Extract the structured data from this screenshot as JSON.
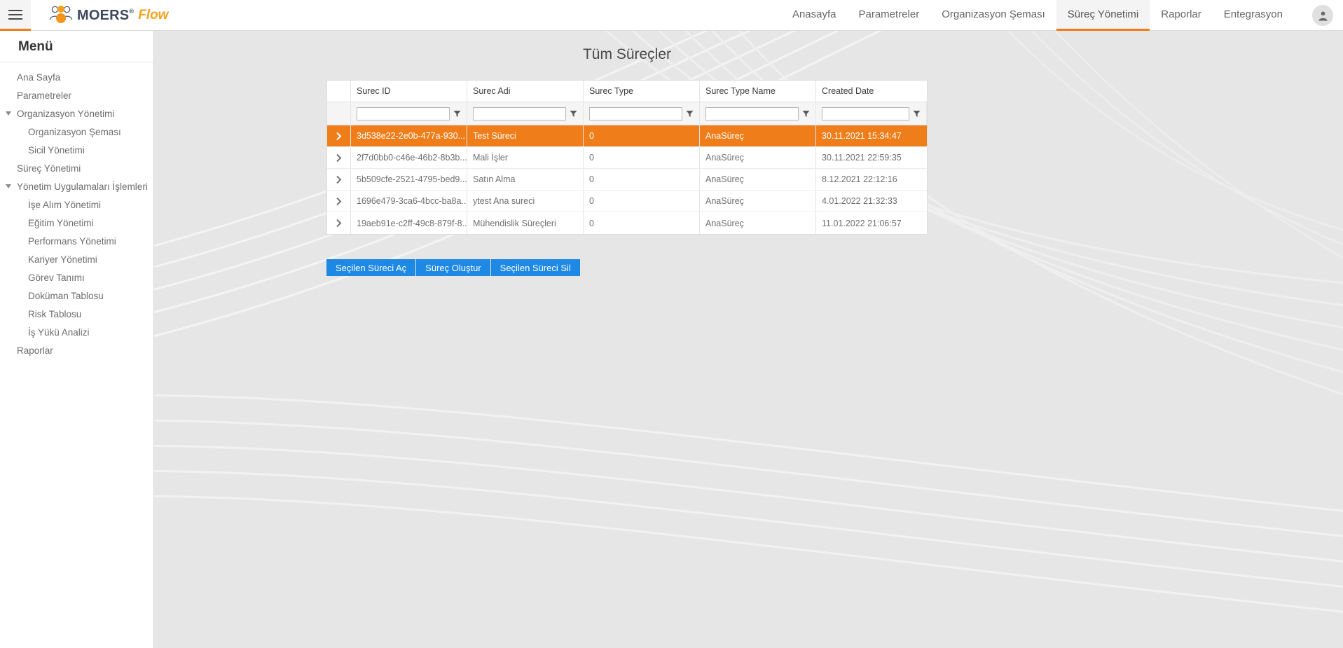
{
  "brand": {
    "name": "MOERS",
    "reg": "®",
    "suffix": "Flow",
    "logo_icon": "people-group-icon",
    "hamburger_icon": "hamburger-menu-icon"
  },
  "topnav": {
    "items": [
      {
        "label": "Anasayfa",
        "active": false
      },
      {
        "label": "Parametreler",
        "active": false
      },
      {
        "label": "Organizasyon Şeması",
        "active": false
      },
      {
        "label": "Süreç Yönetimi",
        "active": true
      },
      {
        "label": "Raporlar",
        "active": false
      },
      {
        "label": "Entegrasyon",
        "active": false
      }
    ],
    "avatar_icon": "user-avatar-icon"
  },
  "sidebar": {
    "title": "Menü",
    "items": [
      {
        "label": "Ana Sayfa",
        "level": 1,
        "caret": "none"
      },
      {
        "label": "Parametreler",
        "level": 1,
        "caret": "none"
      },
      {
        "label": "Organizasyon Yönetimi",
        "level": 1,
        "caret": "open"
      },
      {
        "label": "Organizasyon Şeması",
        "level": 2,
        "caret": "none"
      },
      {
        "label": "Sicil Yönetimi",
        "level": 2,
        "caret": "none"
      },
      {
        "label": "Süreç Yönetimi",
        "level": 1,
        "caret": "none"
      },
      {
        "label": "Yönetim Uygulamaları İşlemleri",
        "level": 1,
        "caret": "open"
      },
      {
        "label": "İşe Alım Yönetimi",
        "level": 2,
        "caret": "none"
      },
      {
        "label": "Eğitim Yönetimi",
        "level": 2,
        "caret": "none"
      },
      {
        "label": "Performans Yönetimi",
        "level": 2,
        "caret": "none"
      },
      {
        "label": "Kariyer Yönetimi",
        "level": 2,
        "caret": "none"
      },
      {
        "label": "Görev Tanımı",
        "level": 2,
        "caret": "none"
      },
      {
        "label": "Doküman Tablosu",
        "level": 2,
        "caret": "none"
      },
      {
        "label": "Risk Tablosu",
        "level": 2,
        "caret": "none"
      },
      {
        "label": "İş Yükü Analizi",
        "level": 2,
        "caret": "none"
      },
      {
        "label": "Raporlar",
        "level": 1,
        "caret": "none"
      }
    ]
  },
  "page": {
    "title": "Tüm Süreçler"
  },
  "grid": {
    "columns": [
      {
        "key": "expand",
        "label": ""
      },
      {
        "key": "id",
        "label": "Surec ID"
      },
      {
        "key": "name",
        "label": "Surec Adi"
      },
      {
        "key": "type",
        "label": "Surec Type"
      },
      {
        "key": "type_name",
        "label": "Surec Type Name"
      },
      {
        "key": "created",
        "label": "Created Date"
      }
    ],
    "filter_row": {
      "filter_icon": "funnel-filter-icon",
      "values": [
        "",
        "",
        "",
        "",
        ""
      ],
      "placeholder": ""
    },
    "expand_icon": "chevron-right-icon",
    "rows": [
      {
        "id": "3d538e22-2e0b-477a-930...",
        "name": "Test Süreci",
        "type": "0",
        "type_name": "AnaSüreç",
        "created": "30.11.2021 15:34:47",
        "selected": true
      },
      {
        "id": "2f7d0bb0-c46e-46b2-8b3b...",
        "name": "Mali İşler",
        "type": "0",
        "type_name": "AnaSüreç",
        "created": "30.11.2021 22:59:35",
        "selected": false
      },
      {
        "id": "5b509cfe-2521-4795-bed9...",
        "name": "Satın Alma",
        "type": "0",
        "type_name": "AnaSüreç",
        "created": "8.12.2021 22:12:16",
        "selected": false
      },
      {
        "id": "1696e479-3ca6-4bcc-ba8a...",
        "name": "ytest Ana sureci",
        "type": "0",
        "type_name": "AnaSüreç",
        "created": "4.01.2022 21:32:33",
        "selected": false
      },
      {
        "id": "19aeb91e-c2ff-49c8-879f-8...",
        "name": "Mühendislik Süreçleri",
        "type": "0",
        "type_name": "AnaSüreç",
        "created": "11.01.2022 21:06:57",
        "selected": false
      }
    ]
  },
  "actions": [
    {
      "label": "Seçilen Süreci Aç"
    },
    {
      "label": "Süreç Oluştur"
    },
    {
      "label": "Seçilen Süreci Sil"
    }
  ],
  "colors": {
    "accent_orange": "#ef7d1a",
    "brand_navy": "#3d4a5c",
    "brand_amber": "#f5a11d",
    "button_blue": "#1e88e5",
    "canvas_gray": "#e6e6e6"
  }
}
